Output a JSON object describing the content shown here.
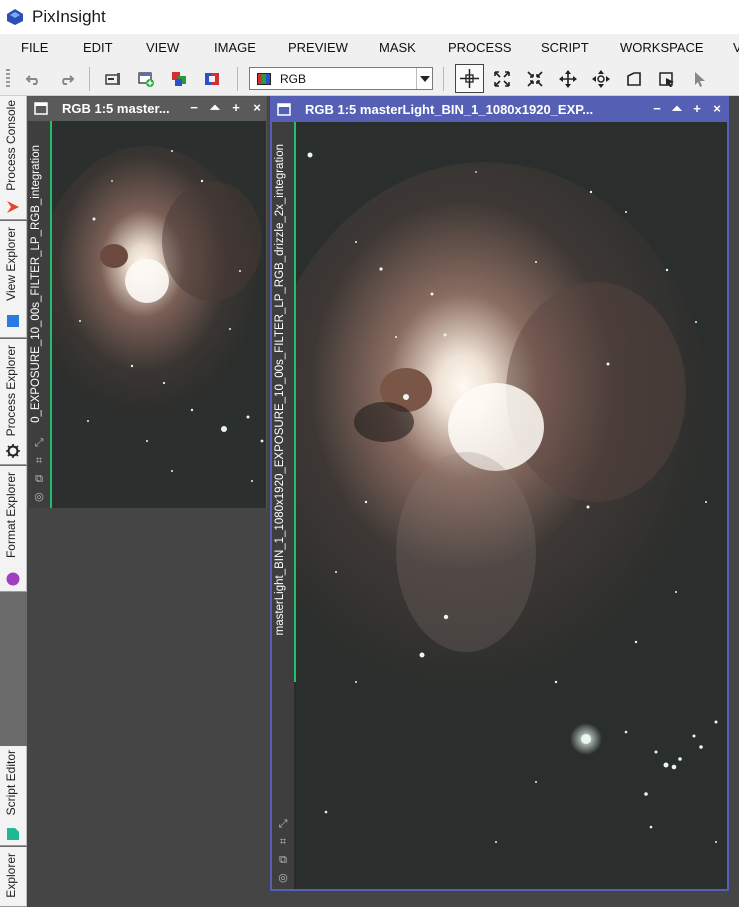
{
  "app": {
    "title": "PixInsight"
  },
  "menu": {
    "items": [
      "FILE",
      "EDIT",
      "VIEW",
      "IMAGE",
      "PREVIEW",
      "MASK",
      "PROCESS",
      "SCRIPT",
      "WORKSPACE",
      "V"
    ]
  },
  "toolbar": {
    "combo_value": "RGB",
    "buttons": [
      "undo-icon",
      "redo-icon",
      "identifier-icon",
      "new-preview-icon",
      "rgb-channels-icon",
      "mask-icon",
      "crosshair-icon",
      "zoom-fit-icon",
      "zoom-in-icon",
      "pan-icon",
      "move-icon",
      "readout-icon",
      "edit-icon",
      "pointer-icon"
    ]
  },
  "sidebar": {
    "tabs": [
      {
        "label": "Process Console",
        "icon": "process-console-icon"
      },
      {
        "label": "View Explorer",
        "icon": "view-explorer-icon"
      },
      {
        "label": "Process Explorer",
        "icon": "process-explorer-icon"
      },
      {
        "label": "Format Explorer",
        "icon": "format-explorer-icon"
      },
      {
        "label": "Script Editor",
        "icon": "script-editor-icon"
      },
      {
        "label": "Explorer",
        "icon": "explorer-icon"
      }
    ]
  },
  "windows": {
    "left": {
      "title": "RGB 1:5 master...",
      "side_label": "0_EXPOSURE_10_00s_FILTER_LP_RGB_integration",
      "controls": [
        "−",
        "⏶",
        "+",
        "×"
      ]
    },
    "right": {
      "title": "RGB 1:5 masterLight_BIN_1_1080x1920_EXP...",
      "side_label": "masterLight_BIN_1_1080x1920_EXPOSURE_10_00s_FILTER_LP_RGB_drizzle_2x_integration",
      "controls": [
        "−",
        "⏶",
        "+",
        "×"
      ]
    }
  },
  "colors": {
    "active_header": "#5560b5",
    "inactive_header": "#5a5a5a",
    "accent_green": "#22c06a"
  }
}
